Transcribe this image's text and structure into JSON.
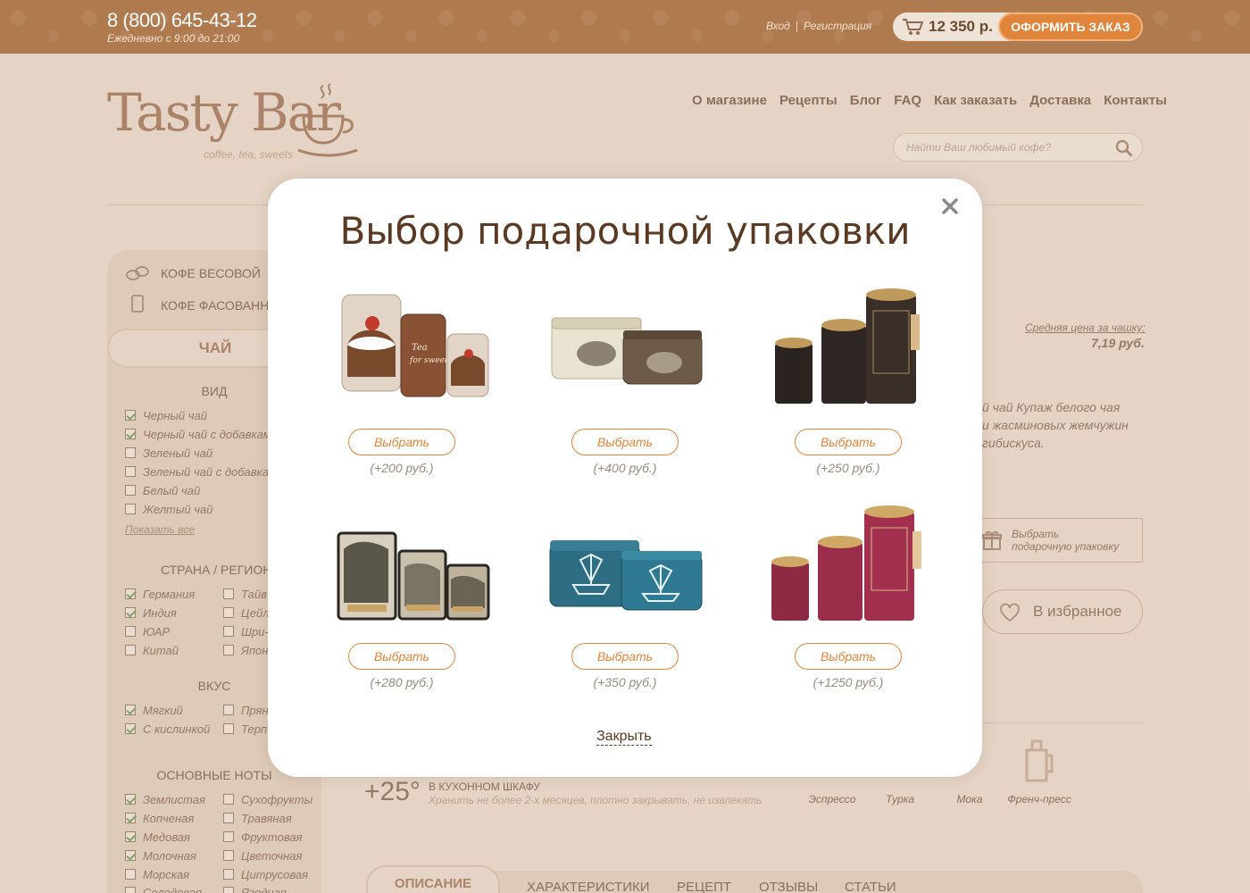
{
  "header": {
    "phone": "8 (800) 645-43-12",
    "hours": "Ежедневно с 9:00 до 21:00",
    "login": "Вход",
    "separator": "|",
    "register": "Регистрация",
    "cart_total": "12 350 р.",
    "order_button": "ОФОРМИТЬ ЗАКАЗ"
  },
  "logo": {
    "name": "Tasty Bar",
    "tagline": "coffee, tea, sweets"
  },
  "nav": [
    "О магазине",
    "Рецепты",
    "Блог",
    "FAQ",
    "Как заказать",
    "Доставка",
    "Контакты"
  ],
  "search": {
    "placeholder": "Найти Ваш любимый кофе?"
  },
  "sidebar": {
    "cat1": "КОФЕ ВЕСОВОЙ",
    "cat2": "КОФЕ ФАСОВАНН",
    "active": "ЧАЙ",
    "sec_vid": "ВИД",
    "vid": [
      {
        "label": "Черный чай",
        "checked": true
      },
      {
        "label": "Черный чай с добавкам",
        "checked": true
      },
      {
        "label": "Зеленый чай",
        "checked": false
      },
      {
        "label": "Зеленый чай с добавка",
        "checked": false
      },
      {
        "label": "Белый чай",
        "checked": false
      },
      {
        "label": "Желтый чай",
        "checked": false
      }
    ],
    "show_all": "Показать все",
    "sec_country": "СТРАНА / РЕГИОН",
    "country": [
      {
        "label": "Германия",
        "checked": true
      },
      {
        "label": "Тайв",
        "checked": false
      },
      {
        "label": "Индия",
        "checked": true
      },
      {
        "label": "Цейл",
        "checked": false
      },
      {
        "label": "ЮАР",
        "checked": false
      },
      {
        "label": "Шри-",
        "checked": false
      },
      {
        "label": "Китай",
        "checked": false
      },
      {
        "label": "Япон",
        "checked": false
      }
    ],
    "sec_taste": "ВКУС",
    "taste": [
      {
        "label": "Мягкий",
        "checked": true
      },
      {
        "label": "Прян",
        "checked": false
      },
      {
        "label": "С кислинкой",
        "checked": true
      },
      {
        "label": "Терп",
        "checked": false
      }
    ],
    "sec_notes": "ОСНОВНЫЕ НОТЫ",
    "notes": [
      {
        "label": "Землистая",
        "checked": true
      },
      {
        "label": "Сухофрукты",
        "checked": false
      },
      {
        "label": "Копченая",
        "checked": true
      },
      {
        "label": "Травяная",
        "checked": false
      },
      {
        "label": "Медовая",
        "checked": true
      },
      {
        "label": "Фруктовая",
        "checked": false
      },
      {
        "label": "Молочная",
        "checked": true
      },
      {
        "label": "Цветочная",
        "checked": false
      },
      {
        "label": "Морская",
        "checked": false
      },
      {
        "label": "Цитрусовая",
        "checked": false
      },
      {
        "label": "Солодовая",
        "checked": false
      },
      {
        "label": "Ягодная",
        "checked": false
      }
    ]
  },
  "product": {
    "avg_label": "Средняя цена за чашку:",
    "avg_value": "7,19 руб.",
    "desc1": "й чай Купаж белого чая",
    "desc2": "и жасминовых жемчужин",
    "desc3": "гибискуса.",
    "gift_line1": "Выбрать",
    "gift_line2": "подарочную упаковку",
    "favorite": "В избранное",
    "temp": "+25°",
    "storage_title": "В КУХОННОМ ШКАФУ",
    "storage_sub": "Хранить не более 2-х месяцев, плотно закрывать, не извлекать",
    "methods": [
      "Эспрессо",
      "Турка",
      "Мока",
      "Френч-пресс"
    ],
    "tabs": [
      "ОПИСАНИЕ",
      "ХАРАКТЕРИСТИКИ",
      "РЕЦЕПТ",
      "ОТЗЫВЫ",
      "СТАТЬИ"
    ]
  },
  "modal": {
    "title": "Выбор подарочной упаковки",
    "choose": "Выбрать",
    "close_link": "Закрыть",
    "items": [
      {
        "price": "(+200 руб.)",
        "image": "cake-tins"
      },
      {
        "price": "(+400 руб.)",
        "image": "elephant-tins"
      },
      {
        "price": "(+250 руб.)",
        "image": "black-tubes"
      },
      {
        "price": "(+280 руб.)",
        "image": "landscape-tins"
      },
      {
        "price": "(+350 руб.)",
        "image": "ship-tins"
      },
      {
        "price": "(+1250 руб.)",
        "image": "burgundy-tubes"
      }
    ]
  },
  "colors": {
    "accent": "#e0853b",
    "brown": "#5a3a22",
    "topbar": "#b07a4f",
    "bg": "#e6d6c6"
  }
}
